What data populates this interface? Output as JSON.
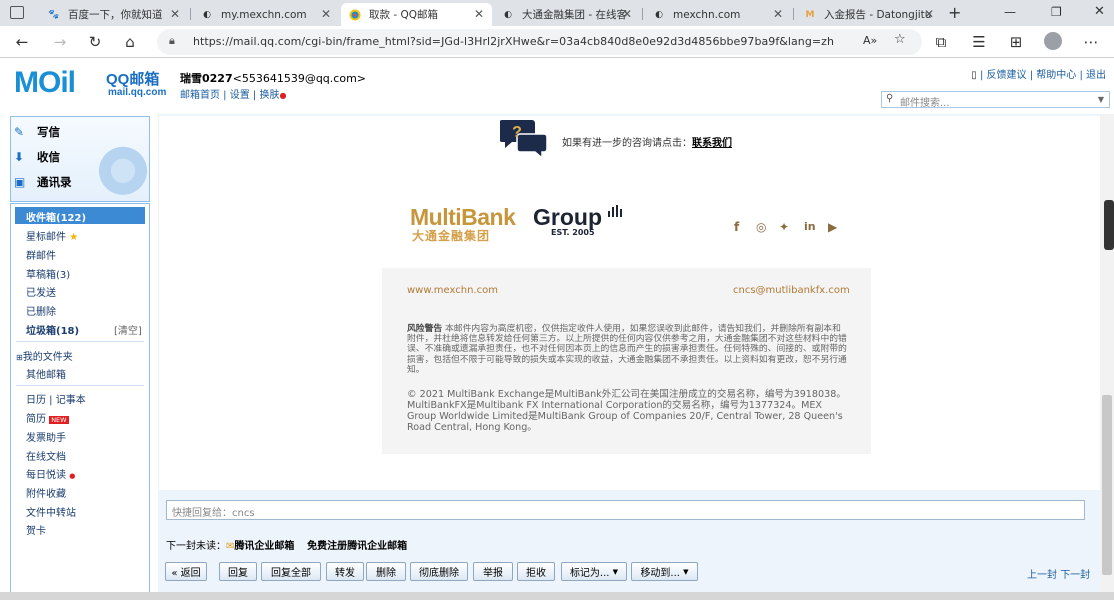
{
  "browser": {
    "tabs": [
      {
        "title": "百度一下，你就知道",
        "icon": "baidu-icon"
      },
      {
        "title": "my.mexchn.com",
        "icon": "page-icon"
      },
      {
        "title": "取款 - QQ邮箱",
        "icon": "qqmail-icon"
      },
      {
        "title": "大通金融集团 - 在线客",
        "icon": "page-icon"
      },
      {
        "title": "mexchn.com",
        "icon": "page-icon"
      },
      {
        "title": "入金报告 - Datongjitu",
        "icon": "report-icon"
      }
    ],
    "new_tab": "+",
    "url": "https://mail.qq.com/cgi-bin/frame_html?sid=JGd-l3Hrl2jrXHwe&r=03a4cb840d8e0e92d3d4856bbe97ba9f&lang=zh"
  },
  "header": {
    "logo_text": "MOil",
    "logo_qq": "QQ邮箱",
    "logo_domain": "mail.qq.com",
    "username": "瑞雪0227",
    "email": "<553641539@qq.com>",
    "links": [
      "邮箱首页",
      "设置",
      "换肤"
    ],
    "top_links": [
      "反馈建议",
      "帮助中心",
      "退出"
    ],
    "search_placeholder": "邮件搜索..."
  },
  "sidebar": {
    "write": "写信",
    "receive": "收信",
    "contacts": "通讯录",
    "inbox": "收件箱(122)",
    "starred": "星标邮件",
    "group": "群邮件",
    "drafts": "草稿箱(3)",
    "sent": "已发送",
    "deleted": "已删除",
    "spam": "垃圾箱(18)",
    "clear": "[清空]",
    "my_folders": "我的文件夹",
    "other": "其他邮箱",
    "calendar": "日历",
    "notes": "记事本",
    "resume": "简历",
    "new_badge": "NEW",
    "assistant": "发票助手",
    "docs": "在线文档",
    "daily": "每日悦读",
    "attach": "附件收藏",
    "transfer": "文件中转站",
    "card": "贺卡"
  },
  "email": {
    "consult": "如果有进一步的咨询请点击：",
    "contact_link": "联系我们",
    "brand": "MultiBank",
    "brand_group": "Group",
    "brand_cn": "大通金融集团",
    "est": "EST. 2005",
    "social": [
      "facebook-icon",
      "instagram-icon",
      "twitter-icon",
      "linkedin-icon",
      "youtube-icon"
    ],
    "website": "www.mexchn.com",
    "contact_email": "cncs@mutlibankfx.com",
    "risk_title": "风险警告",
    "risk_text": "本邮件内容为高度机密，仅供指定收件人使用，如果您误收到此邮件，请告知我们，并删除所有副本和附件，并杜绝将信息转发给任何第三方。以上所提供的任何内容仅供参考之用，大通金融集团不对这些材料中的错误、不准确或遗漏承担责任，也不对任何因本页上的信息而产生的损害承担责任。任何特殊的、间接的、或附带的损害，包括但不限于可能导致的损失或本实现的收益，大通金融集团不承担责任。以上资料如有更改，恕不另行通知。",
    "copyright": "© 2021 MultiBank Exchange是MultiBank外汇公司在美国注册成立的交易名称，编号为3918038。 MultiBankFX是Multibank FX International Corporation的交易名称，编号为1377324。MEX Group Worldwide Limited是MultiBank Group of Companies 20/F, Central Tower, 28 Queen's Road Central, Hong Kong。"
  },
  "reply": {
    "placeholder": "快捷回复给：cncs",
    "next_unread": "下一封未读：",
    "enterprise": "腾讯企业邮箱",
    "free_register": "免费注册腾讯企业邮箱"
  },
  "toolbar": {
    "back": "« 返回",
    "reply": "回复",
    "reply_all": "回复全部",
    "forward": "转发",
    "delete": "删除",
    "delete_forever": "彻底删除",
    "report": "举报",
    "reject": "拒收",
    "mark": "标记为...",
    "move": "移动到...",
    "prev": "上一封",
    "next": "下一封"
  }
}
